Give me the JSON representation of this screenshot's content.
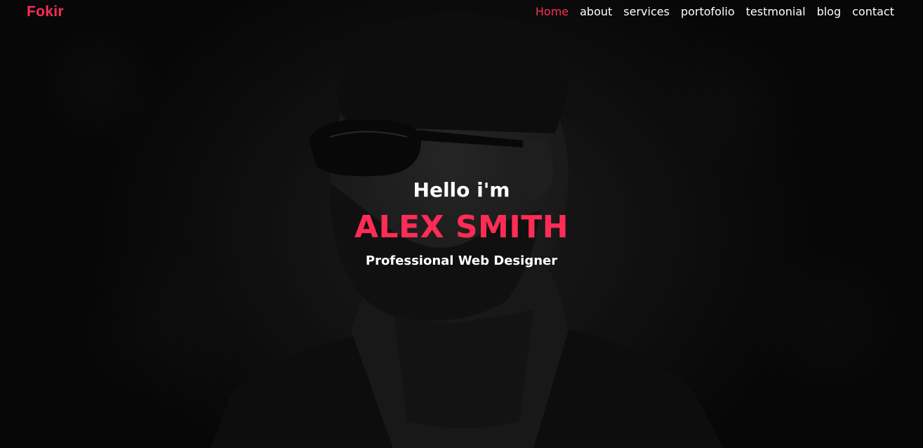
{
  "brand": {
    "name": "Fokir",
    "accent_color": "#ff2d55"
  },
  "nav": {
    "items": [
      {
        "label": "Home",
        "active": true
      },
      {
        "label": "about",
        "active": false
      },
      {
        "label": "services",
        "active": false
      },
      {
        "label": "portofolio",
        "active": false
      },
      {
        "label": "testmonial",
        "active": false
      },
      {
        "label": "blog",
        "active": false
      },
      {
        "label": "contact",
        "active": false
      }
    ]
  },
  "hero": {
    "greeting": "Hello i'm",
    "name": "ALEX SMITH",
    "role": "Professional Web Designer",
    "background_image": "bearded-man-sunglasses-portrait"
  }
}
